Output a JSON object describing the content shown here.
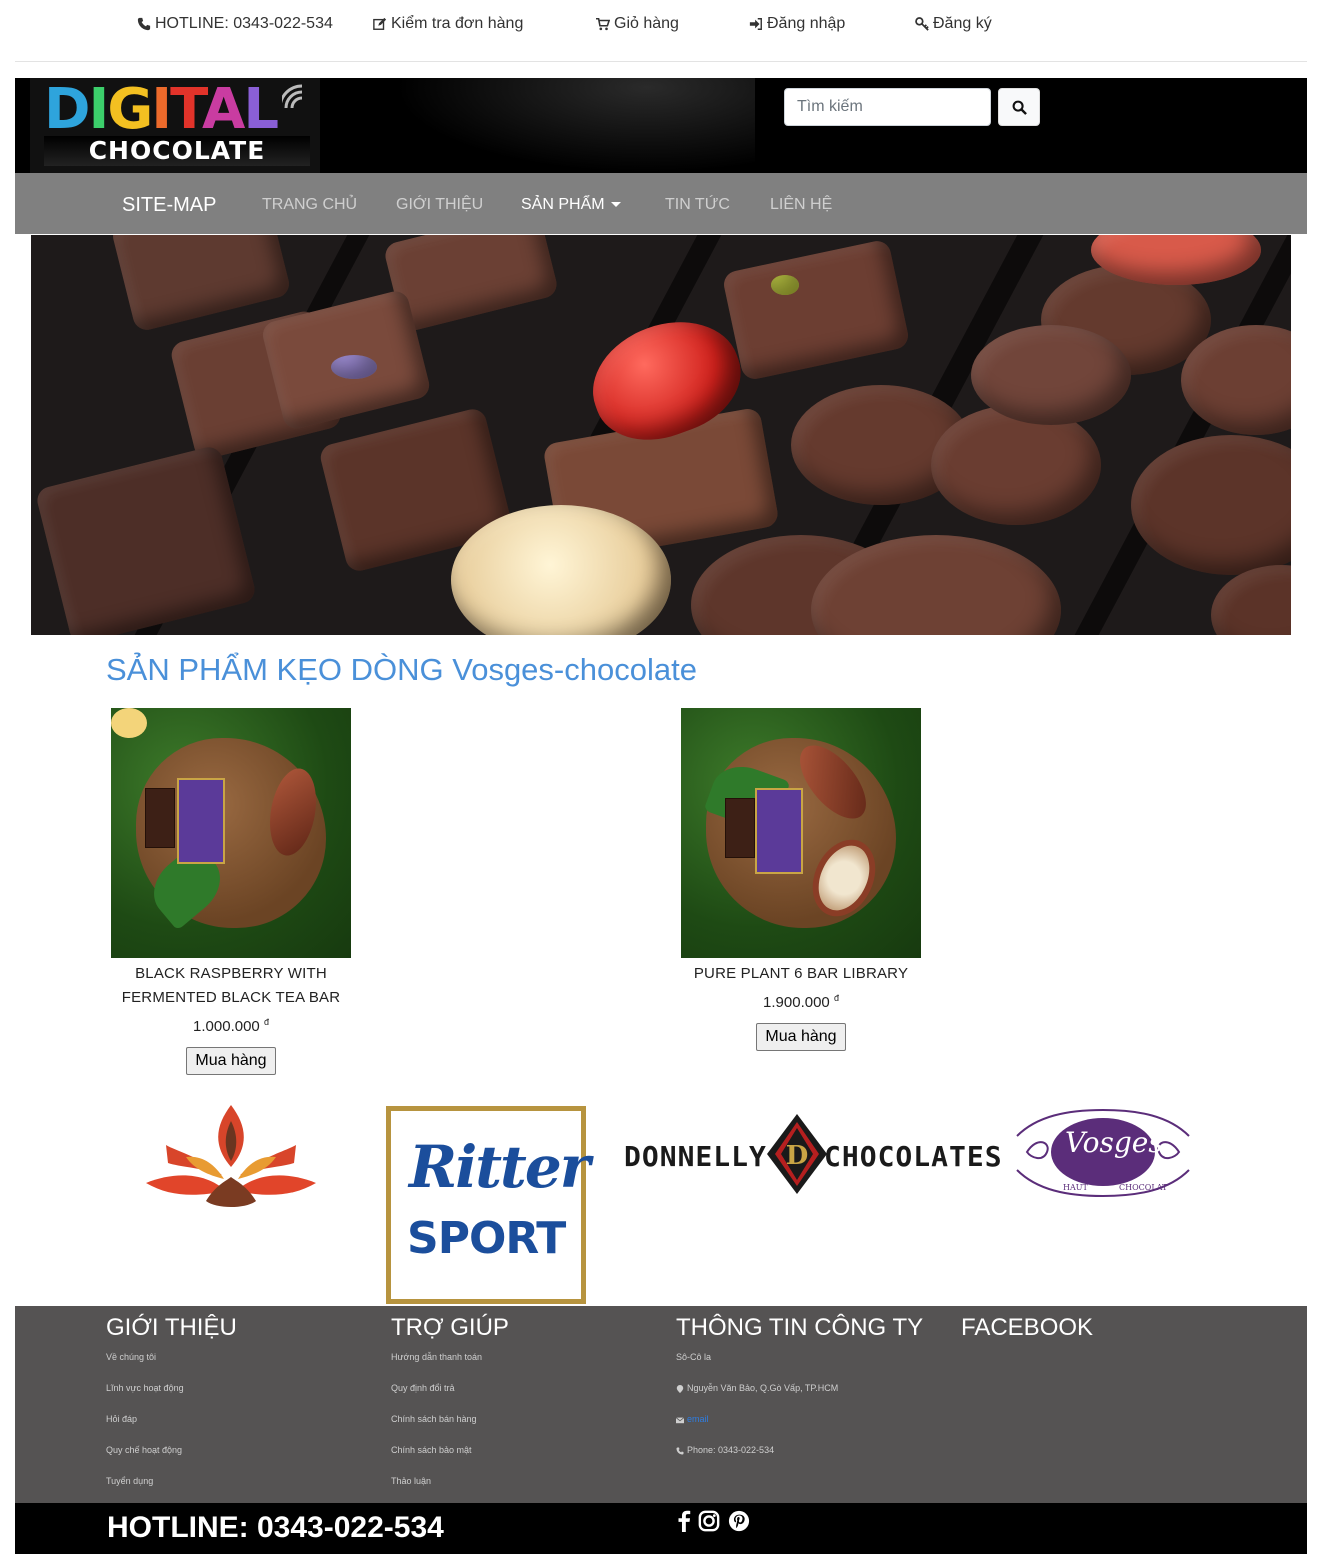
{
  "topbar": {
    "hotline": "HOTLINE: 0343-022-534",
    "check_order": "Kiểm tra đơn hàng",
    "cart": "Giỏ hàng",
    "login": "Đăng nhập",
    "register": "Đăng ký"
  },
  "header": {
    "logo_line1": "DIGITAL",
    "logo_line2": "CHOCOLATE",
    "search_placeholder": "Tìm kiếm"
  },
  "nav": {
    "brand": "SITE-MAP",
    "items": [
      {
        "label": "TRANG CHỦ",
        "active": false
      },
      {
        "label": "GIỚI THIỆU",
        "active": false
      },
      {
        "label": "SẢN PHẨM",
        "active": true,
        "dropdown": true
      },
      {
        "label": "TIN TỨC",
        "active": false
      },
      {
        "label": "LIÊN HỆ",
        "active": false
      }
    ]
  },
  "products": {
    "title_prefix": "SẢN PHẨM KẸO DÒNG",
    "title_line": "Vosges-chocolate",
    "items": [
      {
        "name_line1": "BLACK RASPBERRY WITH",
        "name_line2": "FERMENTED BLACK TEA BAR",
        "price": "1.000.000",
        "currency": "đ",
        "button": "Mua hàng"
      },
      {
        "name_line1": "PURE PLANT 6 BAR LIBRARY",
        "name_line2": "",
        "price": "1.900.000",
        "currency": "đ",
        "button": "Mua hàng"
      }
    ]
  },
  "brands": {
    "ritter_line1": "Ritter",
    "ritter_line2": "SPORT",
    "donnelly_left": "DONNELLY",
    "donnelly_right": "CHOCOLATES",
    "vosges": "Vosges",
    "vosges_haut": "HAUT",
    "vosges_chocolat": "CHOCOLAT"
  },
  "footer": {
    "col1": {
      "heading": "GIỚI THIỆU",
      "links": [
        "Về chúng tôi",
        "Lĩnh vực hoạt động",
        "Hỏi đáp",
        "Quy chế hoạt động",
        "Tuyển dụng"
      ]
    },
    "col2": {
      "heading": "TRỢ GIÚP",
      "links": [
        "Hướng dẫn thanh toán",
        "Quy định đổi trả",
        "Chính sách bán hàng",
        "Chính sách bảo mật",
        "Thảo luận"
      ]
    },
    "col3": {
      "heading": "THÔNG TIN CÔNG TY",
      "company": "Sô-Cô la",
      "address": "Nguyễn Văn Bảo, Q.Gò Vấp, TP.HCM",
      "email": "email",
      "phone": "Phone: 0343-022-534"
    },
    "col4": {
      "heading": "FACEBOOK"
    },
    "hotline": "HOTLINE: 0343-022-534"
  },
  "colors": {
    "accent": "#4a90d9",
    "nav_bg": "#808080",
    "footer_bg": "#555353",
    "header_bg": "#000000"
  }
}
